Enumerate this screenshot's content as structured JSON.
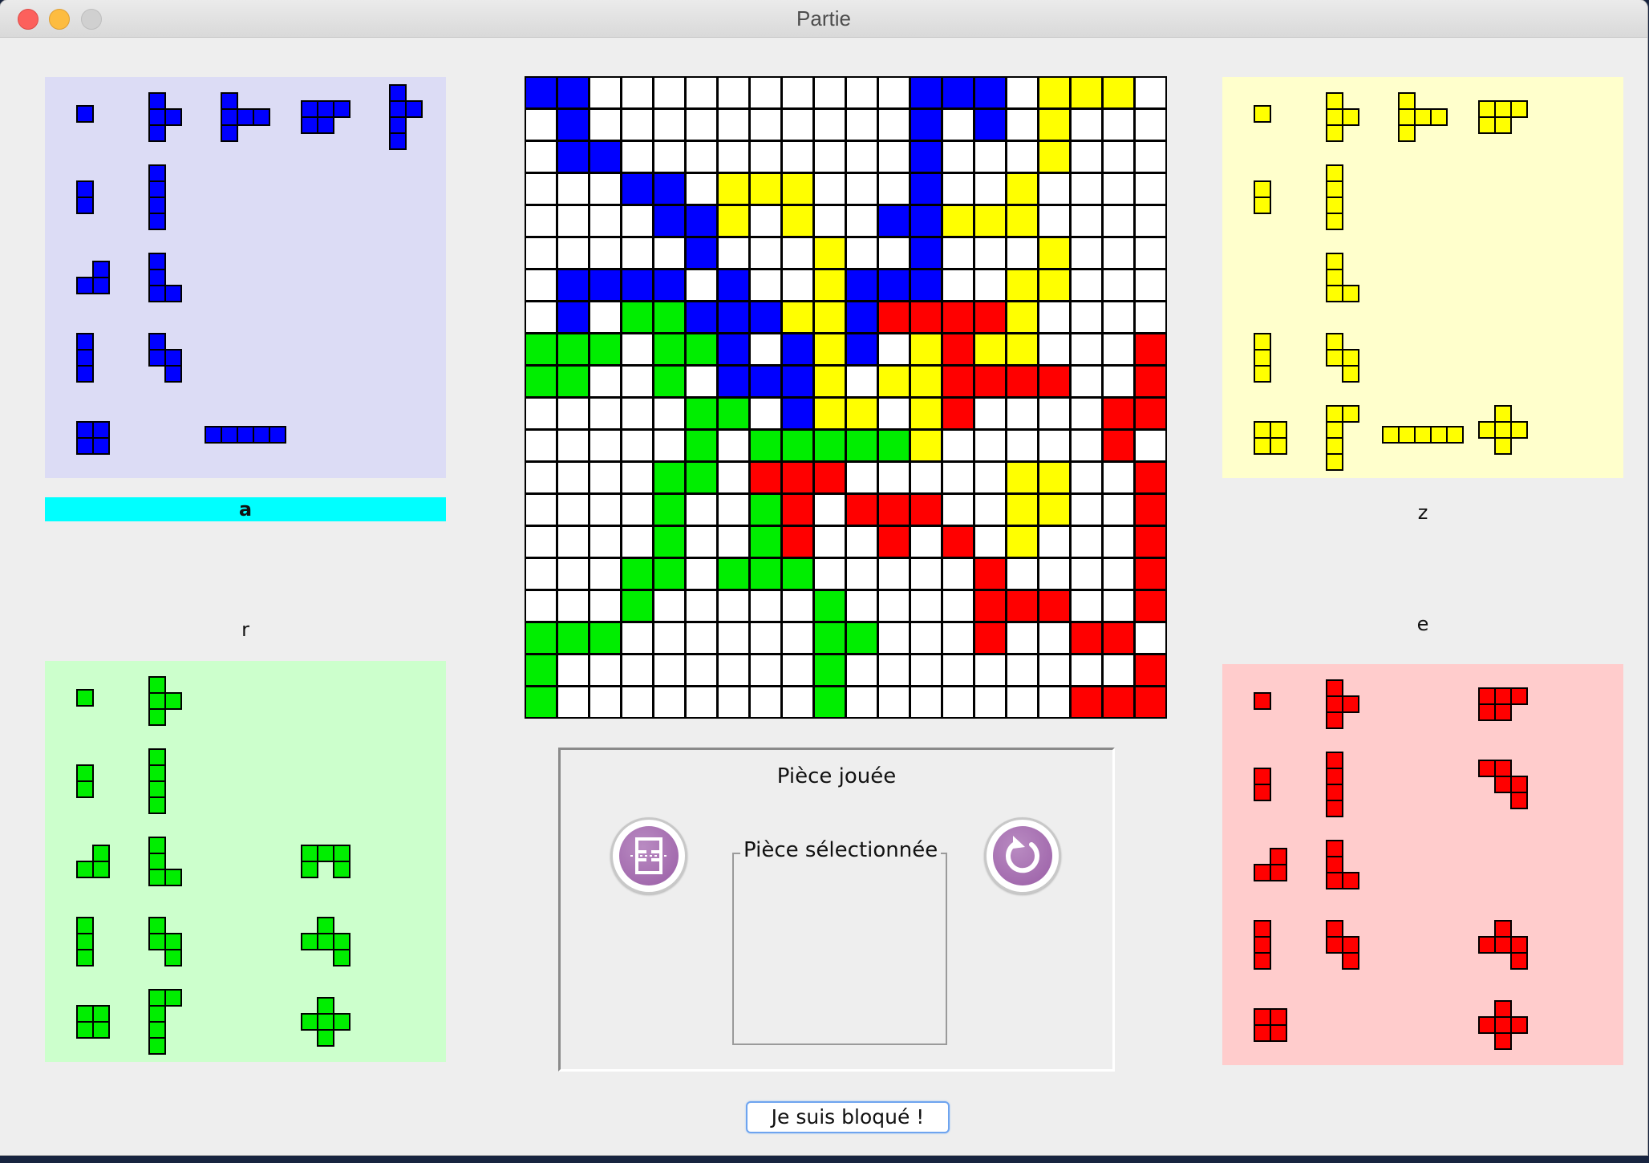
{
  "window": {
    "title": "Partie"
  },
  "colors": {
    "blue": "#0000ff",
    "yellow": "#ffff00",
    "green": "#00ee00",
    "red": "#ff0000",
    "empty": "#ffffff",
    "grid": "#000000",
    "panel_blue": "#dcdcf5",
    "panel_yellow": "#ffffcc",
    "panel_green": "#ccffcc",
    "panel_red": "#ffcccc",
    "active_label": "#00ffff",
    "button_icon": "#a46bb0"
  },
  "board": {
    "size": 20,
    "legend": {
      "B": "blue",
      "Y": "yellow",
      "G": "green",
      "R": "red",
      ".": "empty"
    },
    "rows": [
      "BB..........BBB.YYY.",
      ".B..........B.B.Y...",
      ".BB.........B...Y...",
      "...BB.YYY...B..Y....",
      "....BBY.Y..BBYYY....",
      ".....B...Y..B...Y...",
      ".BBBB.B..YBBB..YY...",
      ".B.GGBBBYYBRRRRY....",
      "GGG.GGB.BYB.YRYY...R",
      "GG..G.BBBY.YYRRRR..R",
      ".....GG.BYY.YR....RR",
      ".....G.GGGGGY.....R.",
      "....GG.RRR.....YY..R",
      "....G..GR.RRR..YY..R",
      "....G..GR..R.R.Y...R",
      "...GG.GGG.....R....R",
      "...G.....G....RRR..R",
      "GGG......GG...R..RR.",
      "G........G.........R",
      "G........G.......RRR"
    ]
  },
  "players": [
    {
      "id": "blue",
      "label": "a",
      "active": true,
      "pieces": [
        {
          "cells": [
            [
              0,
              0
            ]
          ]
        },
        {
          "cells": [
            [
              0,
              0
            ],
            [
              1,
              0
            ],
            [
              2,
              0
            ],
            [
              1,
              1
            ]
          ]
        },
        {
          "cells": [
            [
              0,
              0
            ],
            [
              1,
              0
            ],
            [
              2,
              0
            ],
            [
              1,
              1
            ],
            [
              1,
              2
            ]
          ]
        },
        {
          "cells": [
            [
              0,
              0
            ],
            [
              0,
              1
            ],
            [
              0,
              2
            ],
            [
              1,
              0
            ],
            [
              1,
              1
            ]
          ]
        },
        {
          "cells": [
            [
              0,
              0
            ],
            [
              1,
              0
            ],
            [
              2,
              0
            ],
            [
              3,
              0
            ],
            [
              1,
              1
            ]
          ]
        },
        {
          "cells": [
            [
              0,
              0
            ],
            [
              1,
              0
            ]
          ]
        },
        {
          "cells": [
            [
              0,
              0
            ],
            [
              1,
              0
            ],
            [
              2,
              0
            ],
            [
              3,
              0
            ]
          ]
        },
        {
          "cells": [
            [
              0,
              1
            ],
            [
              1,
              0
            ],
            [
              1,
              1
            ]
          ]
        },
        {
          "cells": [
            [
              0,
              0
            ],
            [
              1,
              0
            ],
            [
              2,
              0
            ],
            [
              2,
              1
            ]
          ]
        },
        {
          "cells": [
            [
              0,
              0
            ],
            [
              1,
              0
            ],
            [
              2,
              0
            ]
          ]
        },
        {
          "cells": [
            [
              0,
              0
            ],
            [
              1,
              0
            ],
            [
              1,
              1
            ],
            [
              2,
              1
            ]
          ]
        },
        {
          "cells": [
            [
              0,
              0
            ],
            [
              0,
              1
            ],
            [
              1,
              0
            ],
            [
              1,
              1
            ]
          ]
        },
        {
          "cells": [
            [
              0,
              0
            ],
            [
              0,
              1
            ],
            [
              0,
              2
            ],
            [
              0,
              3
            ],
            [
              0,
              4
            ]
          ]
        }
      ]
    },
    {
      "id": "yellow",
      "label": "z",
      "active": false,
      "pieces": [
        {
          "cells": [
            [
              0,
              0
            ]
          ]
        },
        {
          "cells": [
            [
              0,
              0
            ],
            [
              1,
              0
            ],
            [
              2,
              0
            ],
            [
              1,
              1
            ]
          ]
        },
        {
          "cells": [
            [
              0,
              0
            ],
            [
              1,
              0
            ],
            [
              2,
              0
            ],
            [
              1,
              1
            ],
            [
              1,
              2
            ]
          ]
        },
        {
          "cells": [
            [
              0,
              0
            ],
            [
              0,
              1
            ],
            [
              0,
              2
            ],
            [
              1,
              0
            ],
            [
              1,
              1
            ]
          ]
        },
        {
          "cells": [
            [
              0,
              0
            ],
            [
              1,
              0
            ]
          ]
        },
        {
          "cells": [
            [
              0,
              0
            ],
            [
              1,
              0
            ],
            [
              2,
              0
            ],
            [
              3,
              0
            ]
          ]
        },
        {
          "cells": [
            [
              0,
              0
            ],
            [
              1,
              0
            ],
            [
              2,
              0
            ],
            [
              2,
              1
            ]
          ]
        },
        {
          "cells": [
            [
              0,
              0
            ],
            [
              1,
              0
            ],
            [
              2,
              0
            ]
          ]
        },
        {
          "cells": [
            [
              0,
              0
            ],
            [
              1,
              0
            ],
            [
              1,
              1
            ],
            [
              2,
              1
            ]
          ]
        },
        {
          "cells": [
            [
              0,
              0
            ],
            [
              0,
              1
            ],
            [
              1,
              0
            ],
            [
              1,
              1
            ]
          ]
        },
        {
          "cells": [
            [
              0,
              0
            ],
            [
              0,
              1
            ],
            [
              1,
              0
            ],
            [
              2,
              0
            ],
            [
              3,
              0
            ]
          ]
        },
        {
          "cells": [
            [
              0,
              0
            ],
            [
              0,
              1
            ],
            [
              0,
              2
            ],
            [
              0,
              3
            ],
            [
              0,
              4
            ]
          ]
        },
        {
          "cells": [
            [
              0,
              1
            ],
            [
              1,
              0
            ],
            [
              1,
              1
            ],
            [
              1,
              2
            ],
            [
              2,
              1
            ]
          ]
        }
      ]
    },
    {
      "id": "green",
      "label": "r",
      "active": false,
      "pieces": [
        {
          "cells": [
            [
              0,
              0
            ]
          ]
        },
        {
          "cells": [
            [
              0,
              0
            ],
            [
              1,
              0
            ],
            [
              2,
              0
            ],
            [
              1,
              1
            ]
          ]
        },
        {
          "cells": [
            [
              0,
              0
            ],
            [
              1,
              0
            ]
          ]
        },
        {
          "cells": [
            [
              0,
              0
            ],
            [
              1,
              0
            ],
            [
              2,
              0
            ],
            [
              3,
              0
            ]
          ]
        },
        {
          "cells": [
            [
              0,
              1
            ],
            [
              1,
              0
            ],
            [
              1,
              1
            ]
          ]
        },
        {
          "cells": [
            [
              0,
              0
            ],
            [
              1,
              0
            ],
            [
              2,
              0
            ],
            [
              2,
              1
            ]
          ]
        },
        {
          "cells": [
            [
              0,
              0
            ],
            [
              0,
              1
            ],
            [
              0,
              2
            ],
            [
              1,
              0
            ],
            [
              1,
              2
            ]
          ]
        },
        {
          "cells": [
            [
              0,
              0
            ],
            [
              1,
              0
            ],
            [
              2,
              0
            ]
          ]
        },
        {
          "cells": [
            [
              0,
              0
            ],
            [
              1,
              0
            ],
            [
              1,
              1
            ],
            [
              2,
              1
            ]
          ]
        },
        {
          "cells": [
            [
              0,
              1
            ],
            [
              1,
              0
            ],
            [
              1,
              1
            ],
            [
              1,
              2
            ],
            [
              2,
              2
            ]
          ]
        },
        {
          "cells": [
            [
              0,
              0
            ],
            [
              0,
              1
            ],
            [
              1,
              0
            ],
            [
              1,
              1
            ]
          ]
        },
        {
          "cells": [
            [
              0,
              0
            ],
            [
              0,
              1
            ],
            [
              1,
              0
            ],
            [
              2,
              0
            ],
            [
              3,
              0
            ]
          ]
        },
        {
          "cells": [
            [
              0,
              1
            ],
            [
              1,
              0
            ],
            [
              1,
              1
            ],
            [
              1,
              2
            ],
            [
              2,
              1
            ]
          ]
        }
      ]
    },
    {
      "id": "red",
      "label": "e",
      "active": false,
      "pieces": [
        {
          "cells": [
            [
              0,
              0
            ]
          ]
        },
        {
          "cells": [
            [
              0,
              0
            ],
            [
              1,
              0
            ],
            [
              2,
              0
            ],
            [
              1,
              1
            ]
          ]
        },
        {
          "cells": [
            [
              0,
              0
            ],
            [
              0,
              1
            ],
            [
              0,
              2
            ],
            [
              1,
              0
            ],
            [
              1,
              1
            ]
          ]
        },
        {
          "cells": [
            [
              0,
              0
            ],
            [
              1,
              0
            ]
          ]
        },
        {
          "cells": [
            [
              0,
              0
            ],
            [
              1,
              0
            ],
            [
              2,
              0
            ],
            [
              3,
              0
            ]
          ]
        },
        {
          "cells": [
            [
              0,
              0
            ],
            [
              0,
              1
            ],
            [
              1,
              1
            ],
            [
              1,
              2
            ],
            [
              2,
              2
            ]
          ]
        },
        {
          "cells": [
            [
              0,
              1
            ],
            [
              1,
              0
            ],
            [
              1,
              1
            ]
          ]
        },
        {
          "cells": [
            [
              0,
              0
            ],
            [
              1,
              0
            ],
            [
              2,
              0
            ],
            [
              2,
              1
            ]
          ]
        },
        {
          "cells": [
            [
              0,
              0
            ],
            [
              1,
              0
            ],
            [
              2,
              0
            ]
          ]
        },
        {
          "cells": [
            [
              0,
              0
            ],
            [
              1,
              0
            ],
            [
              1,
              1
            ],
            [
              2,
              1
            ]
          ]
        },
        {
          "cells": [
            [
              0,
              1
            ],
            [
              1,
              0
            ],
            [
              1,
              1
            ],
            [
              1,
              2
            ],
            [
              2,
              2
            ]
          ]
        },
        {
          "cells": [
            [
              0,
              0
            ],
            [
              0,
              1
            ],
            [
              1,
              0
            ],
            [
              1,
              1
            ]
          ]
        },
        {
          "cells": [
            [
              0,
              1
            ],
            [
              1,
              0
            ],
            [
              1,
              1
            ],
            [
              1,
              2
            ],
            [
              2,
              1
            ]
          ]
        }
      ]
    }
  ],
  "played_piece": {
    "title": "Pièce jouée",
    "selected_title": "Pièce sélectionnée",
    "flip_icon": "flip-icon",
    "rotate_icon": "rotate-icon"
  },
  "blocked_button": "Je suis bloqué !"
}
